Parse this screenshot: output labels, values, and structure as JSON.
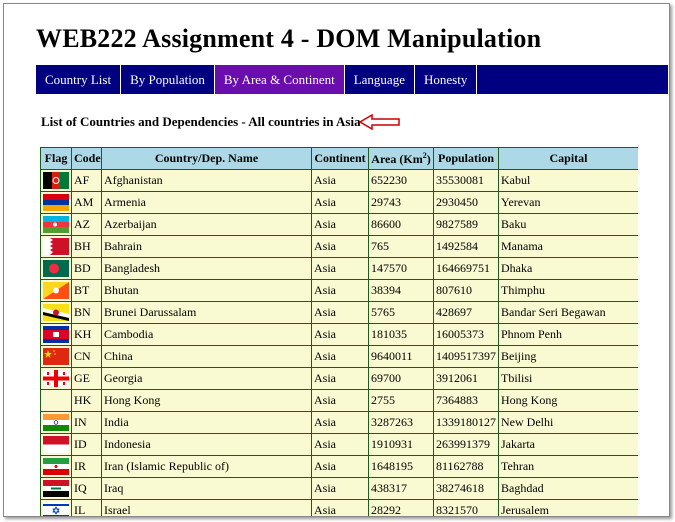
{
  "page": {
    "title": "WEB222 Assignment 4 - DOM Manipulation",
    "subtitle": "List of Countries and Dependencies - All countries in Asia"
  },
  "nav": {
    "items": [
      "Country List",
      "By Population",
      "By Area & Continent",
      "Language",
      "Honesty"
    ],
    "active_index": 2
  },
  "table": {
    "headers": {
      "flag": "Flag",
      "code": "Code",
      "name": "Country/Dep. Name",
      "continent": "Continent",
      "area": "Area (Km",
      "area_sup": "2",
      "area_close": ")",
      "population": "Population",
      "capital": "Capital"
    },
    "rows": [
      {
        "code": "AF",
        "name": "Afghanistan",
        "continent": "Asia",
        "area": "652230",
        "population": "35530081",
        "capital": "Kabul",
        "flag": "af-flag-icon"
      },
      {
        "code": "AM",
        "name": "Armenia",
        "continent": "Asia",
        "area": "29743",
        "population": "2930450",
        "capital": "Yerevan",
        "flag": "am-flag-icon"
      },
      {
        "code": "AZ",
        "name": "Azerbaijan",
        "continent": "Asia",
        "area": "86600",
        "population": "9827589",
        "capital": "Baku",
        "flag": "az-flag-icon"
      },
      {
        "code": "BH",
        "name": "Bahrain",
        "continent": "Asia",
        "area": "765",
        "population": "1492584",
        "capital": "Manama",
        "flag": "bh-flag-icon"
      },
      {
        "code": "BD",
        "name": "Bangladesh",
        "continent": "Asia",
        "area": "147570",
        "population": "164669751",
        "capital": "Dhaka",
        "flag": "bd-flag-icon"
      },
      {
        "code": "BT",
        "name": "Bhutan",
        "continent": "Asia",
        "area": "38394",
        "population": "807610",
        "capital": "Thimphu",
        "flag": "bt-flag-icon"
      },
      {
        "code": "BN",
        "name": "Brunei Darussalam",
        "continent": "Asia",
        "area": "5765",
        "population": "428697",
        "capital": "Bandar Seri Begawan",
        "flag": "bn-flag-icon"
      },
      {
        "code": "KH",
        "name": "Cambodia",
        "continent": "Asia",
        "area": "181035",
        "population": "16005373",
        "capital": "Phnom Penh",
        "flag": "kh-flag-icon"
      },
      {
        "code": "CN",
        "name": "China",
        "continent": "Asia",
        "area": "9640011",
        "population": "1409517397",
        "capital": "Beijing",
        "flag": "cn-flag-icon"
      },
      {
        "code": "GE",
        "name": "Georgia",
        "continent": "Asia",
        "area": "69700",
        "population": "3912061",
        "capital": "Tbilisi",
        "flag": "ge-flag-icon"
      },
      {
        "code": "HK",
        "name": "Hong Kong",
        "continent": "Asia",
        "area": "2755",
        "population": "7364883",
        "capital": "Hong Kong",
        "flag": ""
      },
      {
        "code": "IN",
        "name": "India",
        "continent": "Asia",
        "area": "3287263",
        "population": "1339180127",
        "capital": "New Delhi",
        "flag": "in-flag-icon"
      },
      {
        "code": "ID",
        "name": "Indonesia",
        "continent": "Asia",
        "area": "1910931",
        "population": "263991379",
        "capital": "Jakarta",
        "flag": "id-flag-icon"
      },
      {
        "code": "IR",
        "name": "Iran (Islamic Republic of)",
        "continent": "Asia",
        "area": "1648195",
        "population": "81162788",
        "capital": "Tehran",
        "flag": "ir-flag-icon"
      },
      {
        "code": "IQ",
        "name": "Iraq",
        "continent": "Asia",
        "area": "438317",
        "population": "38274618",
        "capital": "Baghdad",
        "flag": "iq-flag-icon"
      },
      {
        "code": "IL",
        "name": "Israel",
        "continent": "Asia",
        "area": "28292",
        "population": "8321570",
        "capital": "Jerusalem",
        "flag": "il-flag-icon"
      },
      {
        "code": "",
        "name": "",
        "continent": "",
        "area": "",
        "population": "",
        "capital": "",
        "flag": "jp-flag-icon"
      }
    ]
  },
  "colors": {
    "nav_bg": "#000080",
    "nav_active": "#6a0dad",
    "header_bg": "#add8e6",
    "cell_bg": "#fafad2",
    "border": "#1f5a1f",
    "arrow": "#cc0000"
  }
}
